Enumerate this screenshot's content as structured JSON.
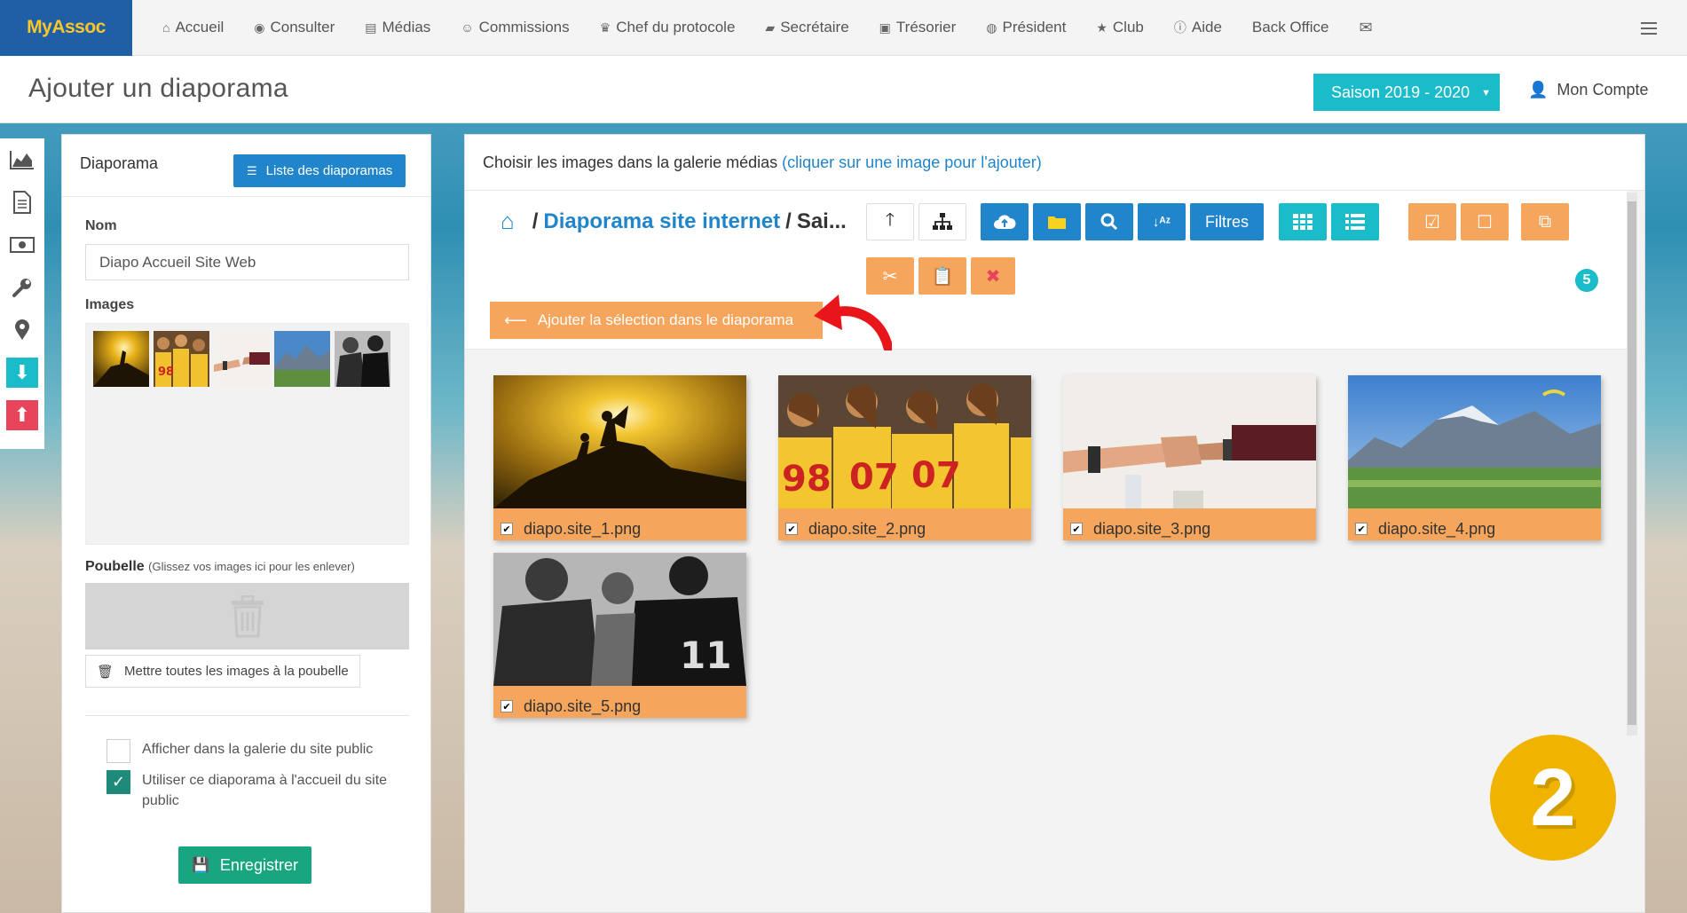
{
  "brand": "MyAssoc",
  "nav": [
    {
      "icon": "home-icon",
      "glyph": "⌂",
      "label": "Accueil"
    },
    {
      "icon": "eye-icon",
      "glyph": "◉",
      "label": "Consulter"
    },
    {
      "icon": "file-icon",
      "glyph": "▤",
      "label": "Médias"
    },
    {
      "icon": "users-icon",
      "glyph": "☺",
      "label": "Commissions"
    },
    {
      "icon": "trophy-icon",
      "glyph": "♛",
      "label": "Chef du protocole"
    },
    {
      "icon": "book-icon",
      "glyph": "▰",
      "label": "Secrétaire"
    },
    {
      "icon": "money-icon",
      "glyph": "▣",
      "label": "Trésorier"
    },
    {
      "icon": "globe-icon",
      "glyph": "◍",
      "label": "Président"
    },
    {
      "icon": "star-icon",
      "glyph": "★",
      "label": "Club"
    },
    {
      "icon": "info-icon",
      "glyph": "ⓘ",
      "label": "Aide"
    },
    {
      "icon": "",
      "glyph": "",
      "label": "Back Office"
    },
    {
      "icon": "envelope-icon",
      "glyph": "✉",
      "label": ""
    }
  ],
  "page_title": "Ajouter un diaporama",
  "season": "Saison 2019 - 2020",
  "account": "Mon Compte",
  "left": {
    "title": "Diaporama",
    "list_button": "Liste des diaporamas",
    "name_label": "Nom",
    "name_value": "Diapo Accueil Site Web",
    "images_label": "Images",
    "trash_label": "Poubelle",
    "trash_hint": "(Glissez vos images ici pour les enlever)",
    "trash_all_button": "Mettre toutes les images à la poubelle",
    "show_gallery": "Afficher dans la galerie du site public",
    "use_home": "Utiliser ce diaporama à l'accueil du site public",
    "save_button": "Enregistrer"
  },
  "right": {
    "heading": "Choisir les images dans la galerie médias",
    "hint": "(cliquer sur une image pour l'ajouter)",
    "crumb_link": "Diaporama site internet",
    "crumb_current": "Sai...",
    "filters": "Filtres",
    "selected_count": "5",
    "add_button": "Ajouter la sélection dans le diaporama",
    "images": [
      {
        "name": "diapo.site_1.png"
      },
      {
        "name": "diapo.site_2.png"
      },
      {
        "name": "diapo.site_3.png"
      },
      {
        "name": "diapo.site_4.png"
      },
      {
        "name": "diapo.site_5.png"
      }
    ]
  },
  "step_number": "2",
  "colors": {
    "brand_bg": "#1f5fa6",
    "brand_text": "#ffc629",
    "blue": "#2185cc",
    "teal": "#1bbcc9",
    "orange": "#f5a55c",
    "green": "#17a67f",
    "step": "#f0b400"
  }
}
